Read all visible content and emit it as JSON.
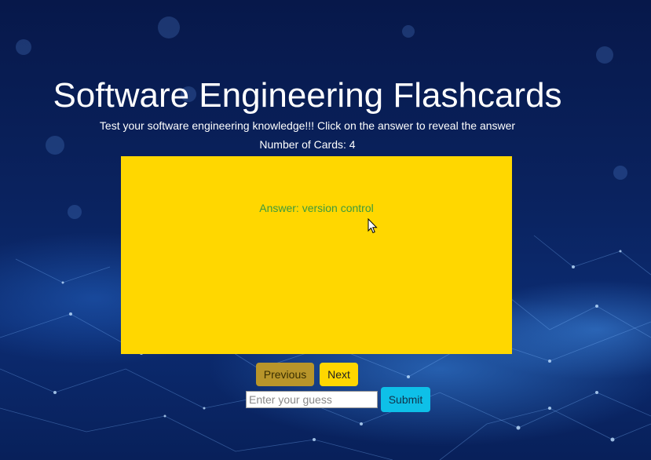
{
  "header": {
    "title": "Software Engineering Flashcards",
    "subtitle": "Test your software engineering knowledge!!! Click on the answer to reveal the answer",
    "card_count_label": "Number of Cards: 4"
  },
  "card": {
    "text": "Answer: version control"
  },
  "nav": {
    "previous_label": "Previous",
    "next_label": "Next"
  },
  "guess": {
    "placeholder": "Enter your guess",
    "value": "",
    "submit_label": "Submit"
  },
  "colors": {
    "card_background": "#ffd700",
    "card_text": "#3d9a3d",
    "previous_button": "#b8952a",
    "next_button": "#ffd700",
    "submit_button": "#0ec0e8",
    "page_background": "#0a2360"
  },
  "icons": {
    "cursor": "arrow-cursor-icon"
  }
}
